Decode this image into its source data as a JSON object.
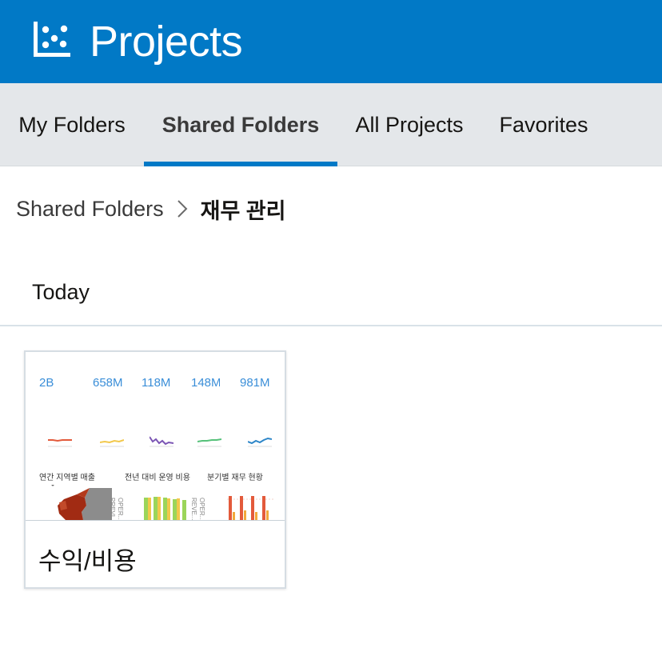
{
  "header": {
    "title": "Projects",
    "logo_icon": "chart-dots-icon",
    "background": "#0179c6"
  },
  "tabs": [
    {
      "label": "My Folders",
      "active": false
    },
    {
      "label": "Shared Folders",
      "active": true
    },
    {
      "label": "All Projects",
      "active": false
    },
    {
      "label": "Favorites",
      "active": false
    }
  ],
  "breadcrumb": {
    "parent": "Shared Folders",
    "separator_icon": "chevron-right-icon",
    "current": "재무 관리"
  },
  "section": {
    "title": "Today"
  },
  "projects": [
    {
      "name": "수익/비용",
      "thumbnail": {
        "kpis": [
          "2B",
          "658M",
          "118M",
          "148M",
          "981M"
        ],
        "sparkline_colors": [
          "#e35a3b",
          "#f2c84b",
          "#7b55b4",
          "#56c17a",
          "#2d86c8"
        ],
        "chart_titles": [
          "연간 지역별 매출",
          "전년 대비 운영 비용",
          "분기별 재무 현황"
        ],
        "axis_labels": [
          "PREVI...",
          "OPER...",
          "REVE...",
          "OPER..."
        ]
      }
    }
  ]
}
